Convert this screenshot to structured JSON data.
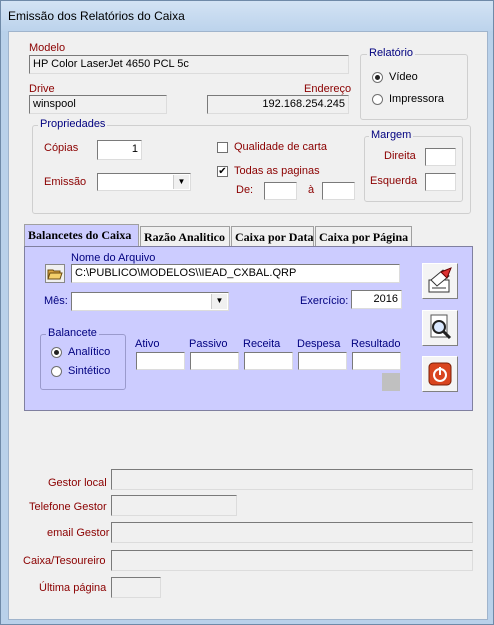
{
  "window": {
    "title": "Emissão dos Relatórios do Caixa"
  },
  "printer": {
    "model_label": "Modelo",
    "model_value": "HP Color LaserJet 4650 PCL 5c",
    "drive_label": "Drive",
    "drive_value": "winspool",
    "address_label": "Endereço",
    "address_value": "192.168.254.245"
  },
  "report": {
    "group_label": "Relatório",
    "options": [
      "Vídeo",
      "Impressora"
    ],
    "selected": "Vídeo"
  },
  "properties": {
    "group_label": "Propriedades",
    "copies_label": "Cópias",
    "copies_value": "1",
    "emission_label": "Emissão",
    "emission_value": "",
    "quality_label": "Qualidade de carta",
    "quality_checked": false,
    "all_pages_label": "Todas as paginas",
    "all_pages_checked": true,
    "from_label": "De:",
    "to_label": "à",
    "from_value": "",
    "to_value": ""
  },
  "margin": {
    "group_label": "Margem",
    "right_label": "Direita",
    "left_label": "Esquerda",
    "right_value": "",
    "left_value": ""
  },
  "tabs": [
    {
      "label": "Balancetes do Caixa",
      "active": true
    },
    {
      "label": "Razão Analitico",
      "active": false
    },
    {
      "label": "Caixa por Data",
      "active": false
    },
    {
      "label": "Caixa por Página",
      "active": false
    }
  ],
  "balancetes": {
    "file_label": "Nome do Arquivo",
    "file_value": "C:\\PUBLICO\\MODELOS\\\\IEAD_CXBAL.QRP",
    "month_label": "Mês:",
    "month_value": "",
    "year_label": "Exercício:",
    "year_value": "2016",
    "balancete_group_label": "Balancete",
    "balancete_options": [
      "Analítico",
      "Sintético"
    ],
    "balancete_selected": "Analítico",
    "columns": [
      "Ativo",
      "Passivo",
      "Receita",
      "Despesa",
      "Resultado"
    ],
    "column_values": [
      "",
      "",
      "",
      "",
      ""
    ]
  },
  "footer": {
    "gestor_local_label": "Gestor local",
    "gestor_local_value": "",
    "telefone_label": "Telefone Gestor",
    "telefone_value": "",
    "email_label": "email Gestor",
    "email_value": "",
    "tesoureiro_label": "Caixa/Tesoureiro",
    "tesoureiro_value": "",
    "ultima_label": "Última página",
    "ultima_value": ""
  },
  "colors": {
    "label_red": "#8b0000",
    "label_navy": "#00007f",
    "panel_bg": "#ccccff",
    "titlebar": "#bcd3ec"
  },
  "icons": [
    "folder-open-icon",
    "print-icon",
    "preview-magnifier-icon",
    "power-exit-icon",
    "dropdown-arrow-icon"
  ]
}
